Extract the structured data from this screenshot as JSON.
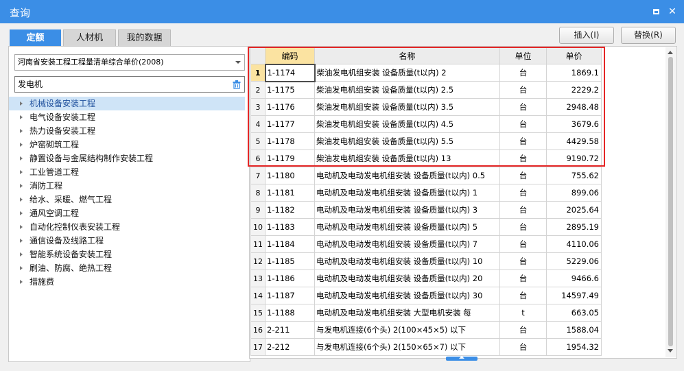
{
  "window": {
    "title": "查询"
  },
  "tabs": [
    {
      "label": "定额",
      "active": true
    },
    {
      "label": "人材机",
      "active": false
    },
    {
      "label": "我的数据",
      "active": false
    }
  ],
  "buttons": {
    "insert": "插入(I)",
    "replace": "替换(R)"
  },
  "left_panel": {
    "library_select": "河南省安装工程工程量清单综合单价(2008)",
    "search_value": "发电机",
    "tree": [
      "机械设备安装工程",
      "电气设备安装工程",
      "热力设备安装工程",
      "炉窑砌筑工程",
      "静置设备与金属结构制作安装工程",
      "工业管道工程",
      "消防工程",
      "给水、采暖、燃气工程",
      "通风空调工程",
      "自动化控制仪表安装工程",
      "通信设备及线路工程",
      "智能系统设备安装工程",
      "刷油、防腐、绝热工程",
      "措施费"
    ],
    "selected_index": 0
  },
  "grid": {
    "headers": {
      "code": "编码",
      "name": "名称",
      "unit": "单位",
      "price": "单价"
    },
    "rows": [
      {
        "n": "1",
        "code": "1-1174",
        "name": "柴油发电机组安装 设备质量(t以内) 2",
        "unit": "台",
        "price": "1869.1"
      },
      {
        "n": "2",
        "code": "1-1175",
        "name": "柴油发电机组安装 设备质量(t以内) 2.5",
        "unit": "台",
        "price": "2229.2"
      },
      {
        "n": "3",
        "code": "1-1176",
        "name": "柴油发电机组安装 设备质量(t以内) 3.5",
        "unit": "台",
        "price": "2948.48"
      },
      {
        "n": "4",
        "code": "1-1177",
        "name": "柴油发电机组安装 设备质量(t以内) 4.5",
        "unit": "台",
        "price": "3679.6"
      },
      {
        "n": "5",
        "code": "1-1178",
        "name": "柴油发电机组安装 设备质量(t以内) 5.5",
        "unit": "台",
        "price": "4429.58"
      },
      {
        "n": "6",
        "code": "1-1179",
        "name": "柴油发电机组安装 设备质量(t以内) 13",
        "unit": "台",
        "price": "9190.72"
      },
      {
        "n": "7",
        "code": "1-1180",
        "name": "电动机及电动发电机组安装 设备质量(t以内) 0.5",
        "unit": "台",
        "price": "755.62"
      },
      {
        "n": "8",
        "code": "1-1181",
        "name": "电动机及电动发电机组安装 设备质量(t以内) 1",
        "unit": "台",
        "price": "899.06"
      },
      {
        "n": "9",
        "code": "1-1182",
        "name": "电动机及电动发电机组安装 设备质量(t以内) 3",
        "unit": "台",
        "price": "2025.64"
      },
      {
        "n": "10",
        "code": "1-1183",
        "name": "电动机及电动发电机组安装 设备质量(t以内) 5",
        "unit": "台",
        "price": "2895.19"
      },
      {
        "n": "11",
        "code": "1-1184",
        "name": "电动机及电动发电机组安装 设备质量(t以内) 7",
        "unit": "台",
        "price": "4110.06"
      },
      {
        "n": "12",
        "code": "1-1185",
        "name": "电动机及电动发电机组安装 设备质量(t以内) 10",
        "unit": "台",
        "price": "5229.06"
      },
      {
        "n": "13",
        "code": "1-1186",
        "name": "电动机及电动发电机组安装 设备质量(t以内) 20",
        "unit": "台",
        "price": "9466.6"
      },
      {
        "n": "14",
        "code": "1-1187",
        "name": "电动机及电动发电机组安装 设备质量(t以内) 30",
        "unit": "台",
        "price": "14597.49"
      },
      {
        "n": "15",
        "code": "1-1188",
        "name": "电动机及电动发电机组安装 大型电机安装 每",
        "unit": "t",
        "price": "663.05"
      },
      {
        "n": "16",
        "code": "2-211",
        "name": "与发电机连接(6个头) 2(100×45×5) 以下",
        "unit": "台",
        "price": "1588.04"
      },
      {
        "n": "17",
        "code": "2-212",
        "name": "与发电机连接(6个头) 2(150×65×7) 以下",
        "unit": "台",
        "price": "1954.32"
      }
    ],
    "current_row": 0
  },
  "colors": {
    "accent": "#3b8ee6",
    "highlight_box": "#e52626",
    "current_cell": "#fbe3a1"
  }
}
